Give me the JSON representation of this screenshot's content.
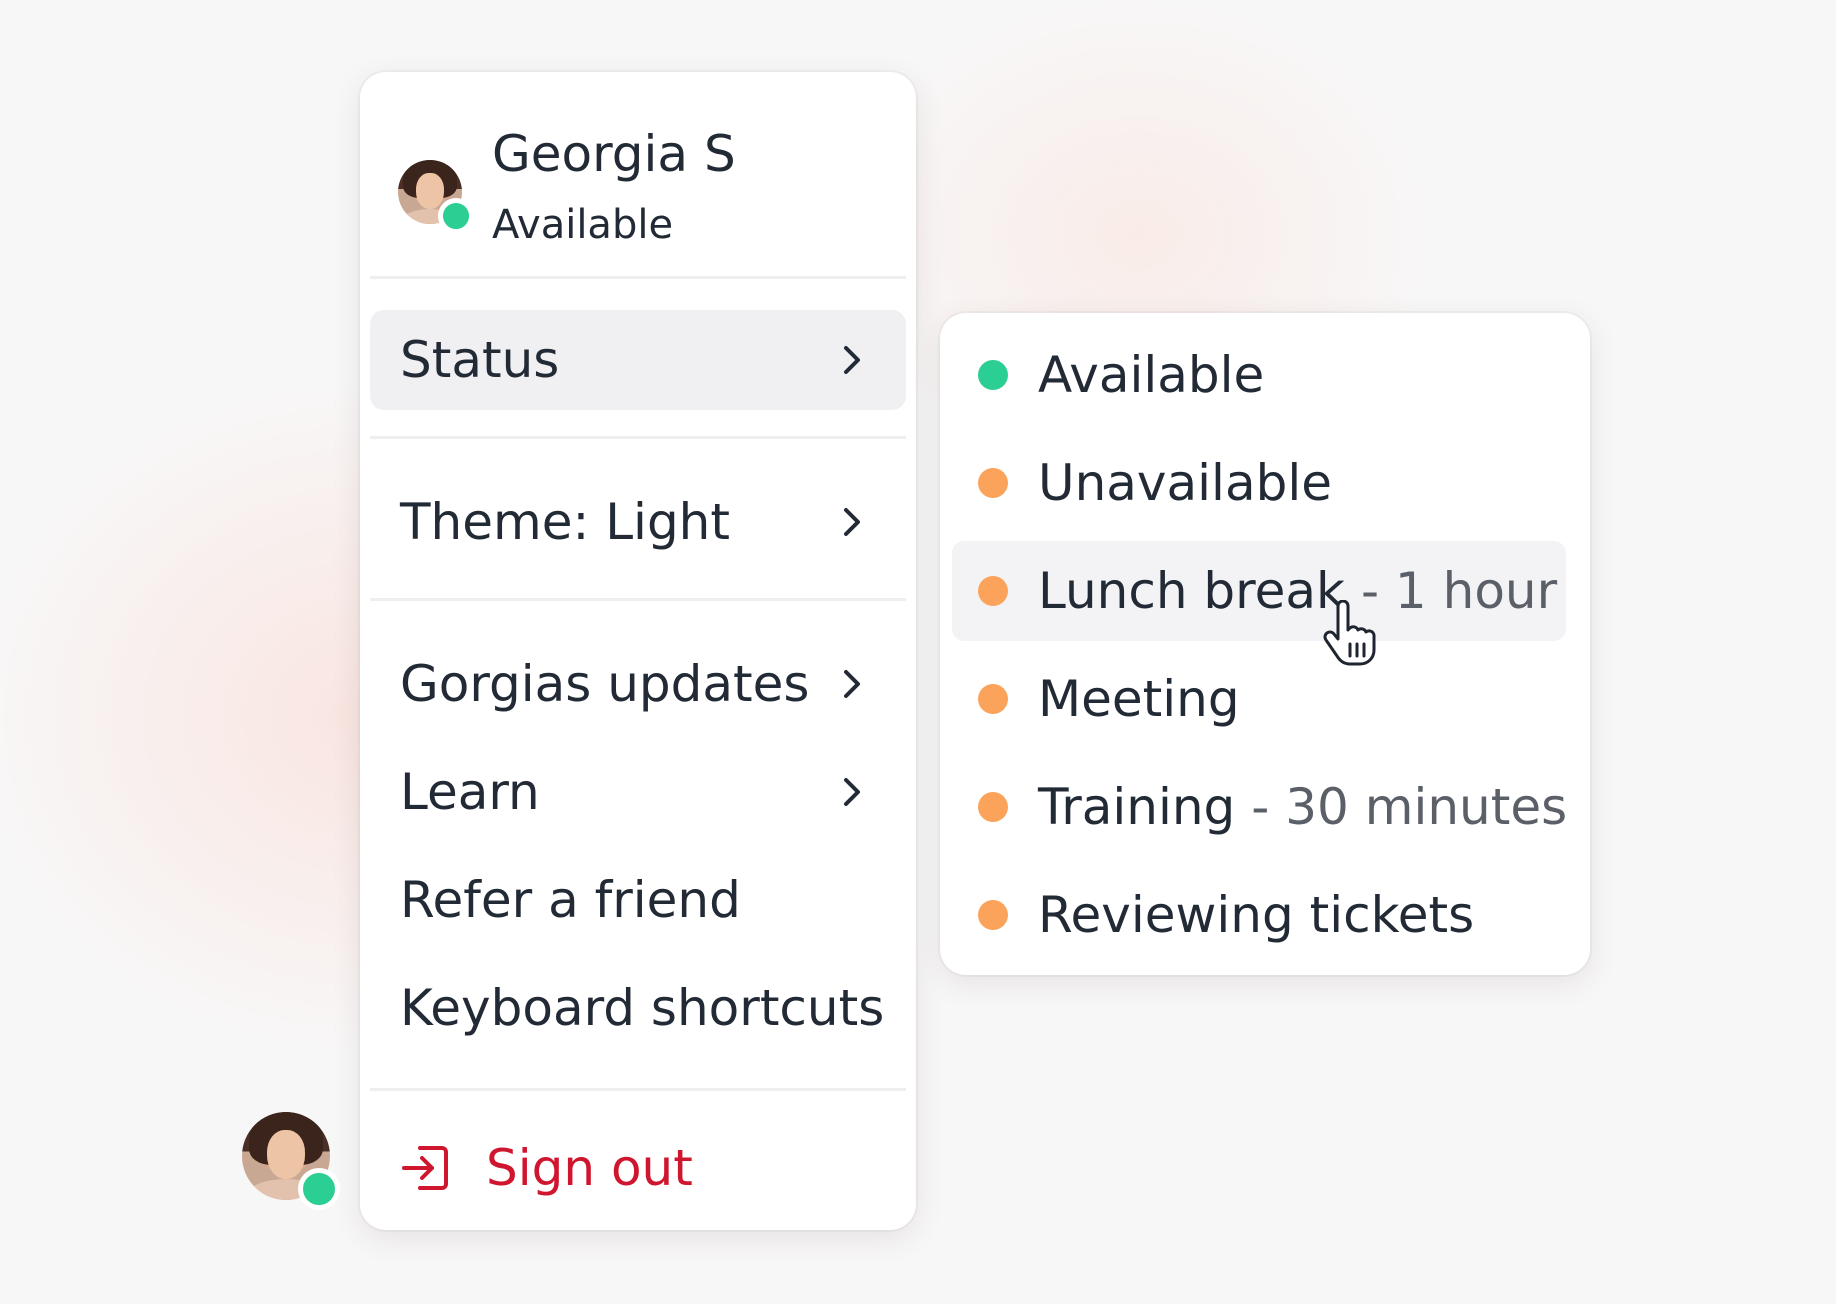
{
  "user": {
    "name": "Georgia S",
    "status": "Available",
    "status_color": "#2ccf93"
  },
  "menu": {
    "items": [
      {
        "label": "Status",
        "has_submenu": true,
        "active": true
      },
      {
        "label": "Theme: Light",
        "has_submenu": true
      },
      {
        "label": "Gorgias updates",
        "has_submenu": true
      },
      {
        "label": "Learn",
        "has_submenu": true
      },
      {
        "label": "Refer a friend",
        "has_submenu": false
      },
      {
        "label": "Keyboard shortcuts",
        "has_submenu": false
      }
    ],
    "sign_out": {
      "label": "Sign out",
      "icon": "sign-out-icon",
      "color": "#d0162f"
    }
  },
  "status_submenu": {
    "items": [
      {
        "label": "Available",
        "detail": "",
        "dot_color": "#2ccf93"
      },
      {
        "label": "Unavailable",
        "detail": "",
        "dot_color": "#fca35b"
      },
      {
        "label": "Lunch break",
        "detail": "- 1 hour",
        "dot_color": "#fca35b",
        "hovered": true
      },
      {
        "label": "Meeting",
        "detail": "",
        "dot_color": "#fca35b"
      },
      {
        "label": "Training",
        "detail": "- 30 minutes",
        "dot_color": "#fca35b"
      },
      {
        "label": "Reviewing tickets",
        "detail": "",
        "dot_color": "#fca35b"
      }
    ]
  },
  "icons": {
    "chevron": "chevron-right-icon",
    "cursor": "hand-pointer-icon"
  }
}
